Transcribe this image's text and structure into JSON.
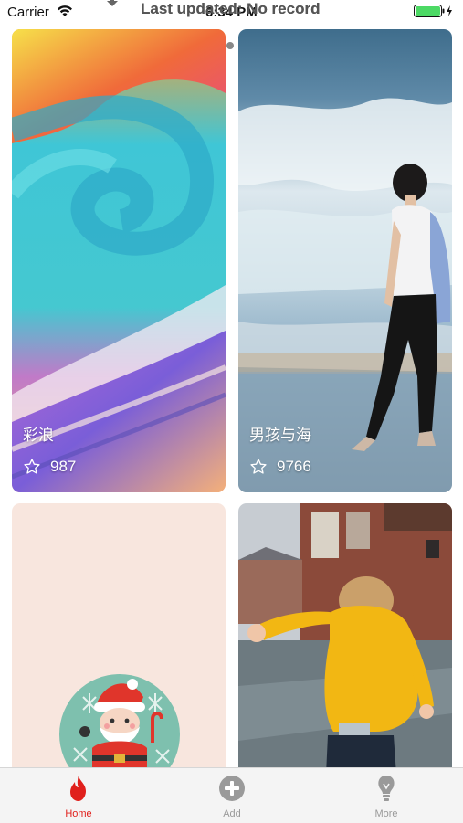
{
  "status_bar": {
    "carrier": "Carrier",
    "time": "6:34 PM"
  },
  "refresh": {
    "text": "Last updated: No record"
  },
  "page_dots": {
    "active_color": "#e0201c",
    "inactive_color": "#888888",
    "count": 3,
    "active_index": 0
  },
  "cards": [
    {
      "title": "彩浪",
      "stars": "987"
    },
    {
      "title": "男孩与海",
      "stars": "9766"
    },
    {
      "title": "",
      "stars": ""
    },
    {
      "title": "",
      "stars": ""
    }
  ],
  "tab_bar": {
    "items": [
      {
        "label": "Home",
        "icon": "flame-icon",
        "color": "#e0201c"
      },
      {
        "label": "Add",
        "icon": "plus-circle-icon",
        "color": "#9a9a9a"
      },
      {
        "label": "More",
        "icon": "lightbulb-icon",
        "color": "#9a9a9a"
      }
    ]
  }
}
